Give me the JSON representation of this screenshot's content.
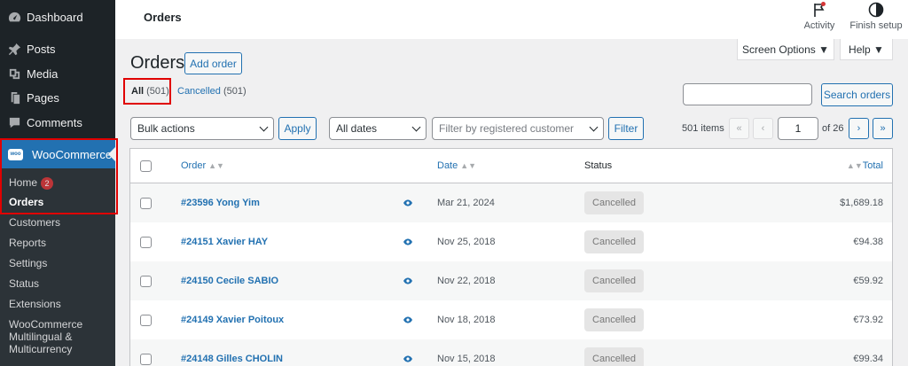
{
  "sidebar": {
    "items": [
      {
        "label": "Dashboard",
        "icon": "dashboard-icon"
      },
      {
        "label": "Posts",
        "icon": "pin-icon"
      },
      {
        "label": "Media",
        "icon": "media-icon"
      },
      {
        "label": "Pages",
        "icon": "pages-icon"
      },
      {
        "label": "Comments",
        "icon": "comment-icon"
      }
    ],
    "woocommerce": {
      "label": "WooCommerce",
      "badge_text": "woo"
    },
    "submenu": [
      {
        "label": "Home",
        "badge": "2"
      },
      {
        "label": "Orders"
      },
      {
        "label": "Customers"
      },
      {
        "label": "Reports"
      },
      {
        "label": "Settings"
      },
      {
        "label": "Status"
      },
      {
        "label": "Extensions"
      },
      {
        "label": "WooCommerce Multilingual & Multicurrency"
      }
    ]
  },
  "header": {
    "breadcrumb": "Orders",
    "activity_label": "Activity",
    "finish_setup_label": "Finish setup",
    "screen_options_label": "Screen Options ▼",
    "help_label": "Help ▼"
  },
  "main": {
    "title": "Orders",
    "add_order_label": "Add order",
    "filters": {
      "all_label": "All",
      "all_count": "(501)",
      "cancelled_label": "Cancelled",
      "cancelled_count": "(501)"
    },
    "search": {
      "value": "",
      "button_label": "Search orders"
    },
    "toolbar": {
      "bulk_actions": "Bulk actions",
      "apply_label": "Apply",
      "dates": "All dates",
      "customer_placeholder": "Filter by registered customer",
      "filter_label": "Filter"
    },
    "pagination": {
      "items": "501 items",
      "first": "«",
      "prev": "‹",
      "current_page": "1",
      "of_pages": "of 26",
      "next": "›",
      "last": "»"
    }
  },
  "table": {
    "columns": {
      "order": "Order",
      "date": "Date",
      "status": "Status",
      "total": "Total"
    },
    "rows": [
      {
        "order": "#23596 Yong Yim",
        "date": "Mar 21, 2024",
        "status": "Cancelled",
        "total": "$1,689.18"
      },
      {
        "order": "#24151 Xavier HAY",
        "date": "Nov 25, 2018",
        "status": "Cancelled",
        "total": "€94.38"
      },
      {
        "order": "#24150 Cecile SABIO",
        "date": "Nov 22, 2018",
        "status": "Cancelled",
        "total": "€59.92"
      },
      {
        "order": "#24149 Xavier Poitoux",
        "date": "Nov 18, 2018",
        "status": "Cancelled",
        "total": "€73.92"
      },
      {
        "order": "#24148 Gilles CHOLIN",
        "date": "Nov 15, 2018",
        "status": "Cancelled",
        "total": "€99.34"
      }
    ]
  },
  "colors": {
    "sidebar_bg": "#1d2327",
    "accent": "#2271b1",
    "highlight": "#e00000"
  }
}
